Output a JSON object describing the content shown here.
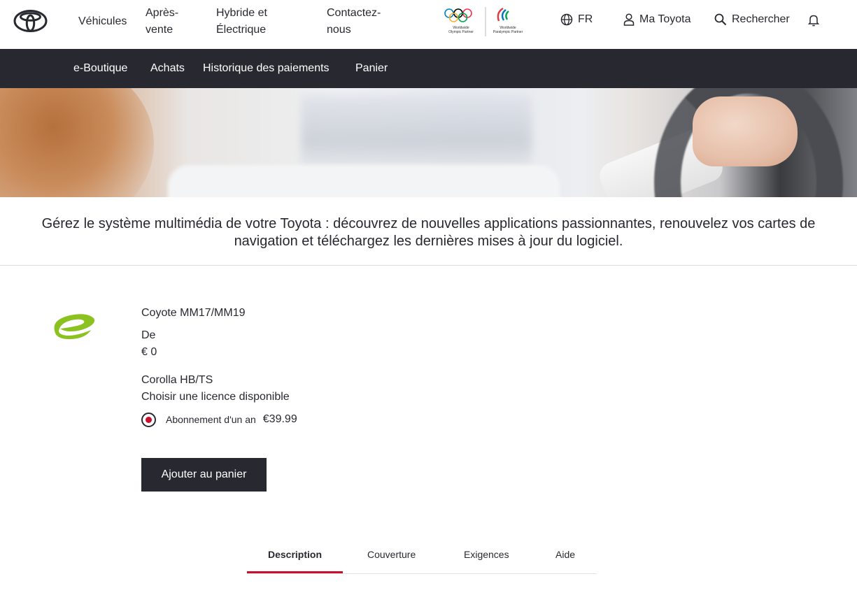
{
  "header": {
    "brand": "Toyota",
    "nav": [
      "Véhicules",
      "Après-\nvente",
      "Hybride et\nÉlectrique",
      "Contactez-\nnous"
    ],
    "partners": {
      "olympic": "Worldwide\nOlympic Partner",
      "paralympic": "Worldwide\nParalympic Partner"
    },
    "language": "FR",
    "account": "Ma Toyota",
    "search": "Rechercher",
    "icons": [
      "globe-icon",
      "user-icon",
      "search-icon",
      "bell-icon"
    ]
  },
  "subnav": [
    "e-Boutique",
    "Achats",
    "Historique des paiements",
    "Panier"
  ],
  "intro": "Gérez le système multimédia de votre Toyota : découvrez de nouvelles applications passionnantes, renouvelez vos cartes de navigation et téléchargez les dernières mises à jour du logiciel.",
  "product": {
    "name": "Coyote MM17/MM19",
    "price_prefix": "De",
    "price": "€ 0",
    "vehicle": "Corolla HB/TS",
    "license_prompt": "Choisir une licence disponible",
    "option_label": "Abonnement d'un an",
    "option_price": "€39.99",
    "option_selected": true,
    "add_to_cart": "Ajouter au panier"
  },
  "tabs": {
    "items": [
      "Description",
      "Couverture",
      "Exigences",
      "Aide"
    ],
    "active": "Description"
  },
  "colors": {
    "dark": "#282830",
    "accent_red": "#c8102e",
    "coyote_green": "#8cc21f"
  }
}
